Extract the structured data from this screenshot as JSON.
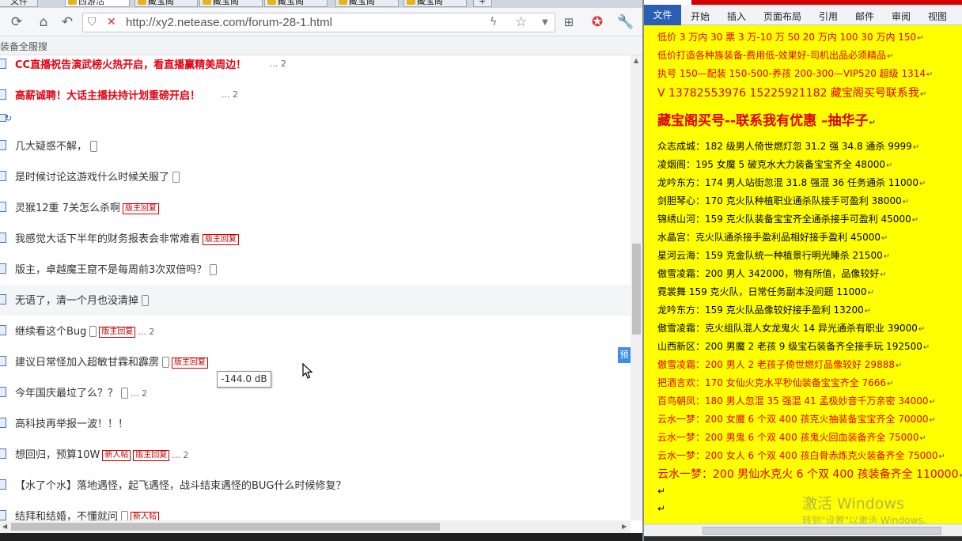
{
  "browser": {
    "tabs": [
      "文件",
      "西游活",
      "藏宝阁",
      "藏宝阁",
      "藏宝阁",
      "藏宝阁",
      "藏宝阁"
    ],
    "url": "http://xy2.netease.com/forum-28-1.html",
    "bookmark_label": "装备全服搜"
  },
  "forum": {
    "top_threads": [
      {
        "title": "CC直播祝告演武榜火热开启，看直播赢精美周边！",
        "pages": "... 2"
      },
      {
        "title": "高薪诚聘！大话主播扶持计划重磅开启！",
        "pages": "... 2"
      }
    ],
    "threads": [
      {
        "title": "几大疑惑不解，",
        "phone": true,
        "badges": [],
        "pages": ""
      },
      {
        "title": "是时候讨论这游戏什么时候关服了",
        "phone": true,
        "badges": [],
        "pages": ""
      },
      {
        "title": "灵猴12重 7关怎么杀啊",
        "phone": false,
        "badges": [
          "版主回复"
        ],
        "pages": ""
      },
      {
        "title": "我感觉大话下半年的财务报表会非常难看",
        "phone": false,
        "badges": [
          "版主回复"
        ],
        "pages": ""
      },
      {
        "title": "版主，卓越魔王窟不是每周前3次双倍吗？",
        "phone": true,
        "badges": [],
        "pages": ""
      },
      {
        "title": "无语了，清一个月也没清掉",
        "phone": true,
        "badges": [],
        "pages": ""
      },
      {
        "title": "继续看这个Bug",
        "phone": true,
        "badges": [
          "版主回复"
        ],
        "pages": "... 2"
      },
      {
        "title": "建议日常怪加入超敏甘霖和霹雳",
        "phone": true,
        "badges": [
          "版主回复"
        ],
        "pages": ""
      },
      {
        "title": "今年国庆最垃了么？？",
        "phone": true,
        "badges": [],
        "pages": "... 2"
      },
      {
        "title": "高科技再举报一波！！！",
        "phone": false,
        "badges": [],
        "pages": ""
      },
      {
        "title": "想回归，预算10W",
        "phone": false,
        "badges": [
          "新人帖",
          "版主回复"
        ],
        "pages": "... 2"
      },
      {
        "title": "【水了个水】落地遇怪，起飞遇怪，战斗结束遇怪的BUG什么时候修复？",
        "phone": false,
        "badges": [],
        "pages": ""
      },
      {
        "title": "结拜和结婚，不懂就问",
        "phone": true,
        "badges": [
          "新人帖"
        ],
        "pages": ""
      }
    ],
    "side_tab": "预",
    "tooltip": "-144.0 dB"
  },
  "word": {
    "ribbon_tabs": [
      "文件",
      "开始",
      "插入",
      "页面布局",
      "引用",
      "邮件",
      "审阅",
      "视图"
    ],
    "lines": [
      {
        "text": "低价 3 万内 30 票  3 万-10 万 50 20 万内 100 30 万内 150",
        "style": "red"
      },
      {
        "text": "低价打造各种族装备-费用低-效果好-司机出品必须精品",
        "style": "red"
      },
      {
        "text": "执号 150—配装 150-500-养孩 200-300—VIP520 超级 1314",
        "style": "red"
      },
      {
        "text": "V 13782553976    15225921182   藏宝阁买号联系我",
        "style": "medium"
      },
      {
        "text": "藏宝阁买号--联系我有优惠 –抽华子",
        "style": "big"
      },
      {
        "text": "众志成城：182 级男人倚世燃灯忽 31.2 强 34.8 通杀 9999",
        "style": "black"
      },
      {
        "text": "凌烟阁：195 女魔 5 破克水大力装备宝宝齐全 48000",
        "style": "black"
      },
      {
        "text": "龙吟东方：174 男人站街忽混 31.8 强混 36 任务通杀 11000",
        "style": "black"
      },
      {
        "text": "剑胆琴心：170 克火队种植职业通杀队接手可盈利 38000",
        "style": "black"
      },
      {
        "text": "锦绣山河：159 克火队装备宝宝齐全通杀接手可盈利 45000",
        "style": "black"
      },
      {
        "text": "水晶宫：克火队通杀接手盈利品相好接手盈利 45000",
        "style": "black"
      },
      {
        "text": "星河云海：159 克金队统一种植景行明光睡杀 21500",
        "style": "black"
      },
      {
        "text": "傲雪凌霜：200 男人 342000，物有所值，品像较好",
        "style": "black"
      },
      {
        "text": "霓裳舞 159 克火队，日常任务副本没问题 11000",
        "style": "black"
      },
      {
        "text": "龙吟东方：159 克火队品像较好接手盈利 13200",
        "style": "black"
      },
      {
        "text": "傲雪凌霜：克火组队混人女龙鬼火 14 异光通杀有职业 39000",
        "style": "black"
      },
      {
        "text": "山西新区：200 男魔 2 老孩 9 级宝石装备齐全接手玩 192500",
        "style": "black"
      },
      {
        "text": "傲雪凌霜：200 男人 2 老孩子倚世燃灯品像较好 29888",
        "style": "red"
      },
      {
        "text": "把酒言欢：170 女仙火克水平秒仙装备宝宝齐全 7666",
        "style": "red"
      },
      {
        "text": "百鸟朝凤：180 男人忽混 35 强混 41 孟极妙音千万亲密 34000",
        "style": "red"
      },
      {
        "text": "云水一梦：200 女魔 6 个双 400 孩克火抽装备宝宝齐全 70000",
        "style": "red"
      },
      {
        "text": "云水一梦：200 男鬼 6 个双 400 孩鬼火回血装备齐全 75000",
        "style": "red"
      },
      {
        "text": "云水一梦：200 女人 6 个双 400 孩白骨赤炼克火装备齐全 75000",
        "style": "red"
      },
      {
        "text": "云水一梦：200 男仙水克火 6 个双 400 孩装备齐全 110000",
        "style": "medium"
      }
    ],
    "watermark_title": "激活 Windows",
    "watermark_sub": "转到\"设置\"以激活 Windows。"
  }
}
